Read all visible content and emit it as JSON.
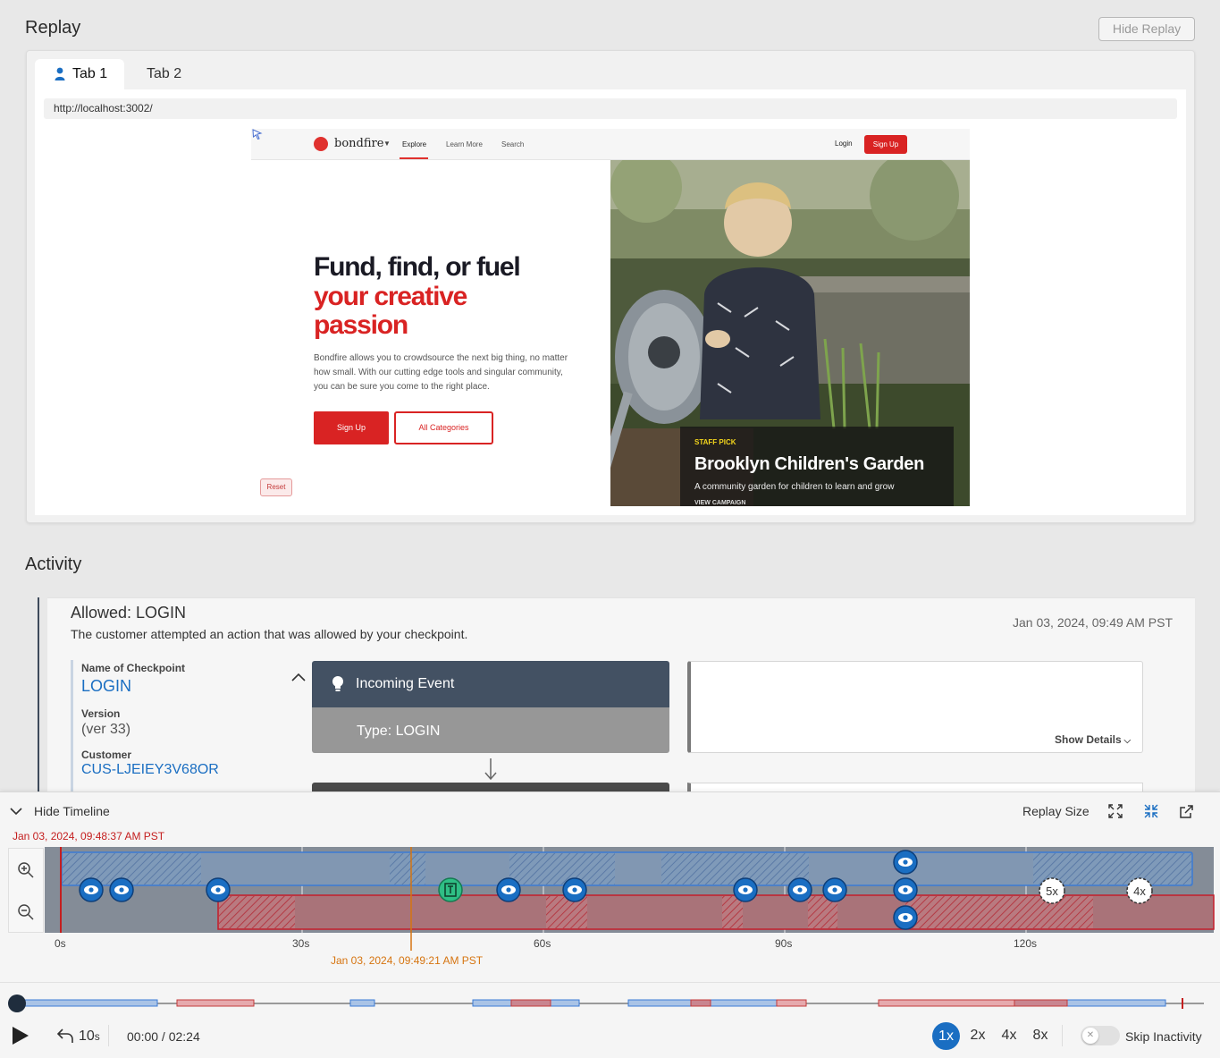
{
  "replay": {
    "title": "Replay",
    "hide_button": "Hide Replay",
    "tabs": [
      {
        "label": "Tab 1",
        "icon": "person-icon"
      },
      {
        "label": "Tab 2"
      }
    ],
    "url": "http://localhost:3002/"
  },
  "site": {
    "brand": "bondfire",
    "nav": {
      "explore": "Explore",
      "learn": "Learn More",
      "search": "Search",
      "login": "Login",
      "signup": "Sign Up"
    },
    "hero": {
      "line1": "Fund, find, or fuel",
      "line2": "your creative",
      "line3": "passion",
      "description": "Bondfire allows you to crowdsource the next big thing, no matter how small. With our cutting edge tools and singular community, you can be sure you come to the right place.",
      "signup": "Sign Up",
      "categories": "All Categories"
    },
    "reset": "Reset",
    "campaign": {
      "badge": "STAFF PICK",
      "title": "Brooklyn Children's Garden",
      "description": "A community garden for children to learn and grow",
      "cta": "VIEW CAMPAIGN"
    },
    "brand_color": "#d92323"
  },
  "activity": {
    "title": "Activity",
    "event": {
      "title": "Allowed: LOGIN",
      "description": "The customer attempted an action that was allowed by your checkpoint.",
      "timestamp": "Jan 03, 2024, 09:49 AM PST",
      "checkpoint_label": "Name of Checkpoint",
      "checkpoint_value": "LOGIN",
      "version_label": "Version",
      "version_value": "(ver 33)",
      "customer_label": "Customer",
      "customer_value": "CUS-LJEIEY3V68OR",
      "incoming_event": "Incoming Event",
      "type": "Type: LOGIN",
      "show_details": "Show Details"
    }
  },
  "timeline": {
    "hide_label": "Hide Timeline",
    "replay_size": "Replay Size",
    "start_time": "Jan 03, 2024, 09:48:37 AM PST",
    "cursor_time": "Jan 03, 2024, 09:49:21 AM PST",
    "ticks": [
      "0s",
      "30s",
      "60s",
      "90s",
      "120s"
    ],
    "markers": {
      "speed_a": "5x",
      "speed_b": "4x"
    },
    "colors": {
      "blue": "#3a7bd5",
      "red": "#c43a3a",
      "green": "#2fbf85",
      "cursor": "#d67410",
      "start": "#c41e1e"
    }
  },
  "controls": {
    "back": "10",
    "back_unit": "s",
    "time": "00:00 / 02:24",
    "speeds": [
      "1x",
      "2x",
      "4x",
      "8x"
    ],
    "selected_speed": "1x",
    "skip_label": "Skip Inactivity",
    "skip_enabled": false
  }
}
